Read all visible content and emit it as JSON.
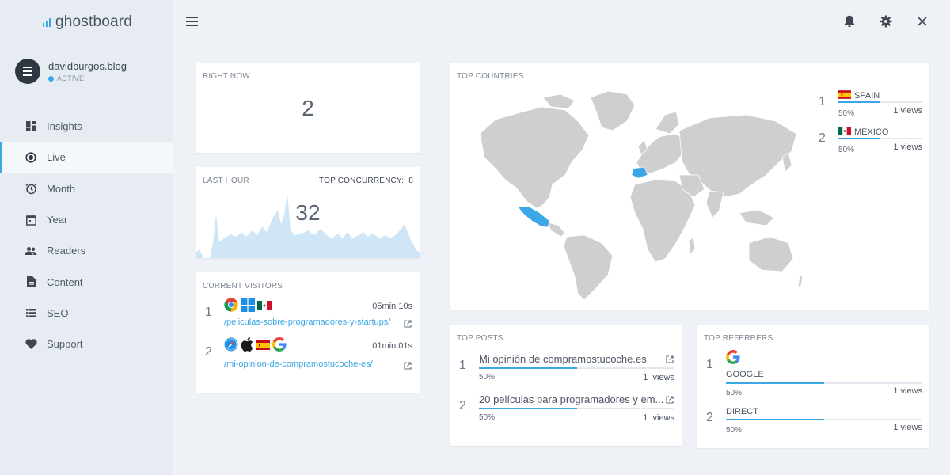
{
  "app": {
    "logo_text": "ghostboard"
  },
  "account": {
    "name": "davidburgos.blog",
    "status": "ACTIVE"
  },
  "sidebar": {
    "items": [
      {
        "label": "Insights",
        "icon": "dashboard-icon"
      },
      {
        "label": "Live",
        "icon": "live-dot-icon",
        "active": true
      },
      {
        "label": "Month",
        "icon": "alarm-clock-icon"
      },
      {
        "label": "Year",
        "icon": "calendar-icon"
      },
      {
        "label": "Readers",
        "icon": "people-icon"
      },
      {
        "label": "Content",
        "icon": "document-icon"
      },
      {
        "label": "SEO",
        "icon": "list-icon"
      },
      {
        "label": "Support",
        "icon": "heart-icon"
      }
    ]
  },
  "topbar": {
    "icons": [
      "bell-icon",
      "gear-icon",
      "close-icon"
    ]
  },
  "right_now": {
    "title": "RIGHT NOW",
    "value": "2"
  },
  "last_hour": {
    "title": "LAST HOUR",
    "concurrency_label": "TOP CONCURRENCY:",
    "concurrency_value": "8",
    "value": "32"
  },
  "current_visitors": {
    "title": "CURRENT VISITORS",
    "rows": [
      {
        "num": "1",
        "icons": [
          "chrome-icon",
          "windows-icon",
          "mexico-flag-icon"
        ],
        "time": "05min 10s",
        "path": "/peliculas-sobre-programadores-y-startups/"
      },
      {
        "num": "2",
        "icons": [
          "safari-icon",
          "apple-icon",
          "spain-flag-icon",
          "google-icon"
        ],
        "time": "01min 01s",
        "path": "/mi-opinion-de-compramostucoche-es/"
      }
    ]
  },
  "top_countries": {
    "title": "TOP COUNTRIES",
    "rows": [
      {
        "num": "1",
        "name": "SPAIN",
        "pct": "50%",
        "fraction": 0.5,
        "views": "1 views"
      },
      {
        "num": "2",
        "name": "MEXICO",
        "pct": "50%",
        "fraction": 0.5,
        "views": "1 views"
      }
    ]
  },
  "top_posts": {
    "title": "TOP POSTS",
    "rows": [
      {
        "num": "1",
        "title": "Mi opinión de compramostucoche.es",
        "pct": "50%",
        "fraction": 0.5,
        "views": "1  views"
      },
      {
        "num": "2",
        "title": "20 películas para programadores y em...",
        "pct": "50%",
        "fraction": 0.5,
        "views": "1  views"
      }
    ]
  },
  "top_referrers": {
    "title": "TOP REFERRERS",
    "rows": [
      {
        "num": "1",
        "name": "GOOGLE",
        "pct": "50%",
        "fraction": 0.5,
        "views": "1 views"
      },
      {
        "num": "2",
        "name": "DIRECT",
        "pct": "50%",
        "fraction": 0.5,
        "views": "1 views"
      }
    ]
  },
  "colors": {
    "accent": "#3ba7e6",
    "map_land": "#cfcfcf",
    "map_highlight": "#3ba7e6",
    "chart_fill": "#cfe6f7"
  }
}
